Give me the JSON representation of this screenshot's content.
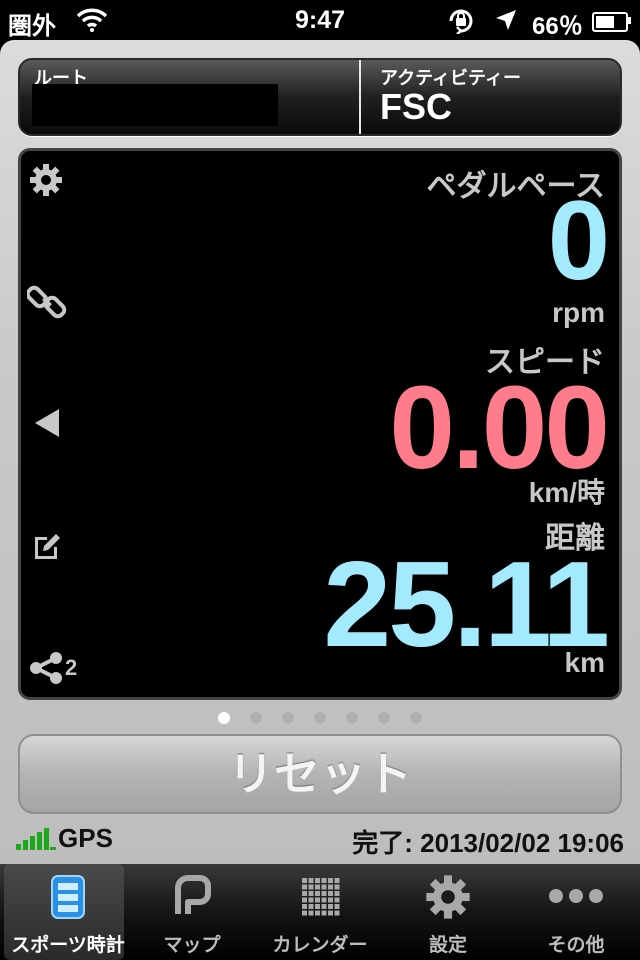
{
  "status_bar": {
    "carrier": "圏外",
    "time": "9:47",
    "battery": "66％",
    "battery_level": 0.66
  },
  "header": {
    "route_label": "ルート",
    "route_value": "",
    "activity_label": "アクティビティー",
    "activity_value": "FSC"
  },
  "metrics": {
    "cadence": {
      "label": "ペダルペース",
      "value": "0",
      "unit": "rpm",
      "color": "#a4eaff"
    },
    "speed": {
      "label": "スピード",
      "value": "0.00",
      "unit": "km/時",
      "color": "#ff7c8c"
    },
    "distance": {
      "label": "距離",
      "value": "25.11",
      "unit": "km",
      "color": "#a4eaff"
    }
  },
  "side_icons": {
    "settings": "gear-icon",
    "link": "chain-link-icon",
    "back": "left-triangle-icon",
    "edit": "edit-icon",
    "share": "share-icon",
    "share_count": "2"
  },
  "pager": {
    "count": 7,
    "active": 0
  },
  "reset_button": "リセット",
  "footer": {
    "gps": "GPS",
    "completed": "完了: 2013/02/02 19:06"
  },
  "tabs": [
    {
      "label": "スポーツ時計",
      "icon": "stopwatch-icon",
      "active": true
    },
    {
      "label": "マップ",
      "icon": "map-icon",
      "active": false
    },
    {
      "label": "カレンダー",
      "icon": "calendar-icon",
      "active": false
    },
    {
      "label": "設定",
      "icon": "gear-icon",
      "active": false
    },
    {
      "label": "その他",
      "icon": "more-icon",
      "active": false
    }
  ]
}
